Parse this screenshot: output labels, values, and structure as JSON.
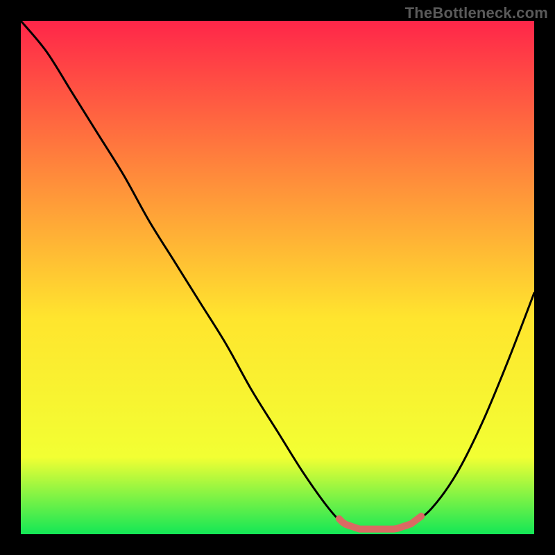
{
  "watermark": "TheBottleneck.com",
  "colors": {
    "bg": "#000000",
    "watermark": "#5a5a5a",
    "curve": "#000000",
    "highlight": "#da6a63",
    "gradient_top": "#ff2649",
    "gradient_upper_mid": "#ff8a3b",
    "gradient_mid": "#ffe52e",
    "gradient_lower_mid": "#f2ff33",
    "gradient_bottom": "#13e756"
  },
  "chart_data": {
    "type": "line",
    "title": "",
    "xlabel": "",
    "ylabel": "",
    "xlim": [
      0,
      100
    ],
    "ylim": [
      0,
      100
    ],
    "x": [
      0,
      5,
      10,
      15,
      20,
      25,
      30,
      35,
      40,
      45,
      50,
      55,
      60,
      63,
      66,
      70,
      73,
      76,
      80,
      85,
      90,
      95,
      100
    ],
    "values": [
      100,
      94,
      86,
      78,
      70,
      61,
      53,
      45,
      37,
      28,
      20,
      12,
      5,
      2,
      1,
      1,
      1,
      2,
      5,
      12,
      22,
      34,
      47
    ],
    "highlight_range_x": [
      62,
      78
    ],
    "annotations": []
  }
}
